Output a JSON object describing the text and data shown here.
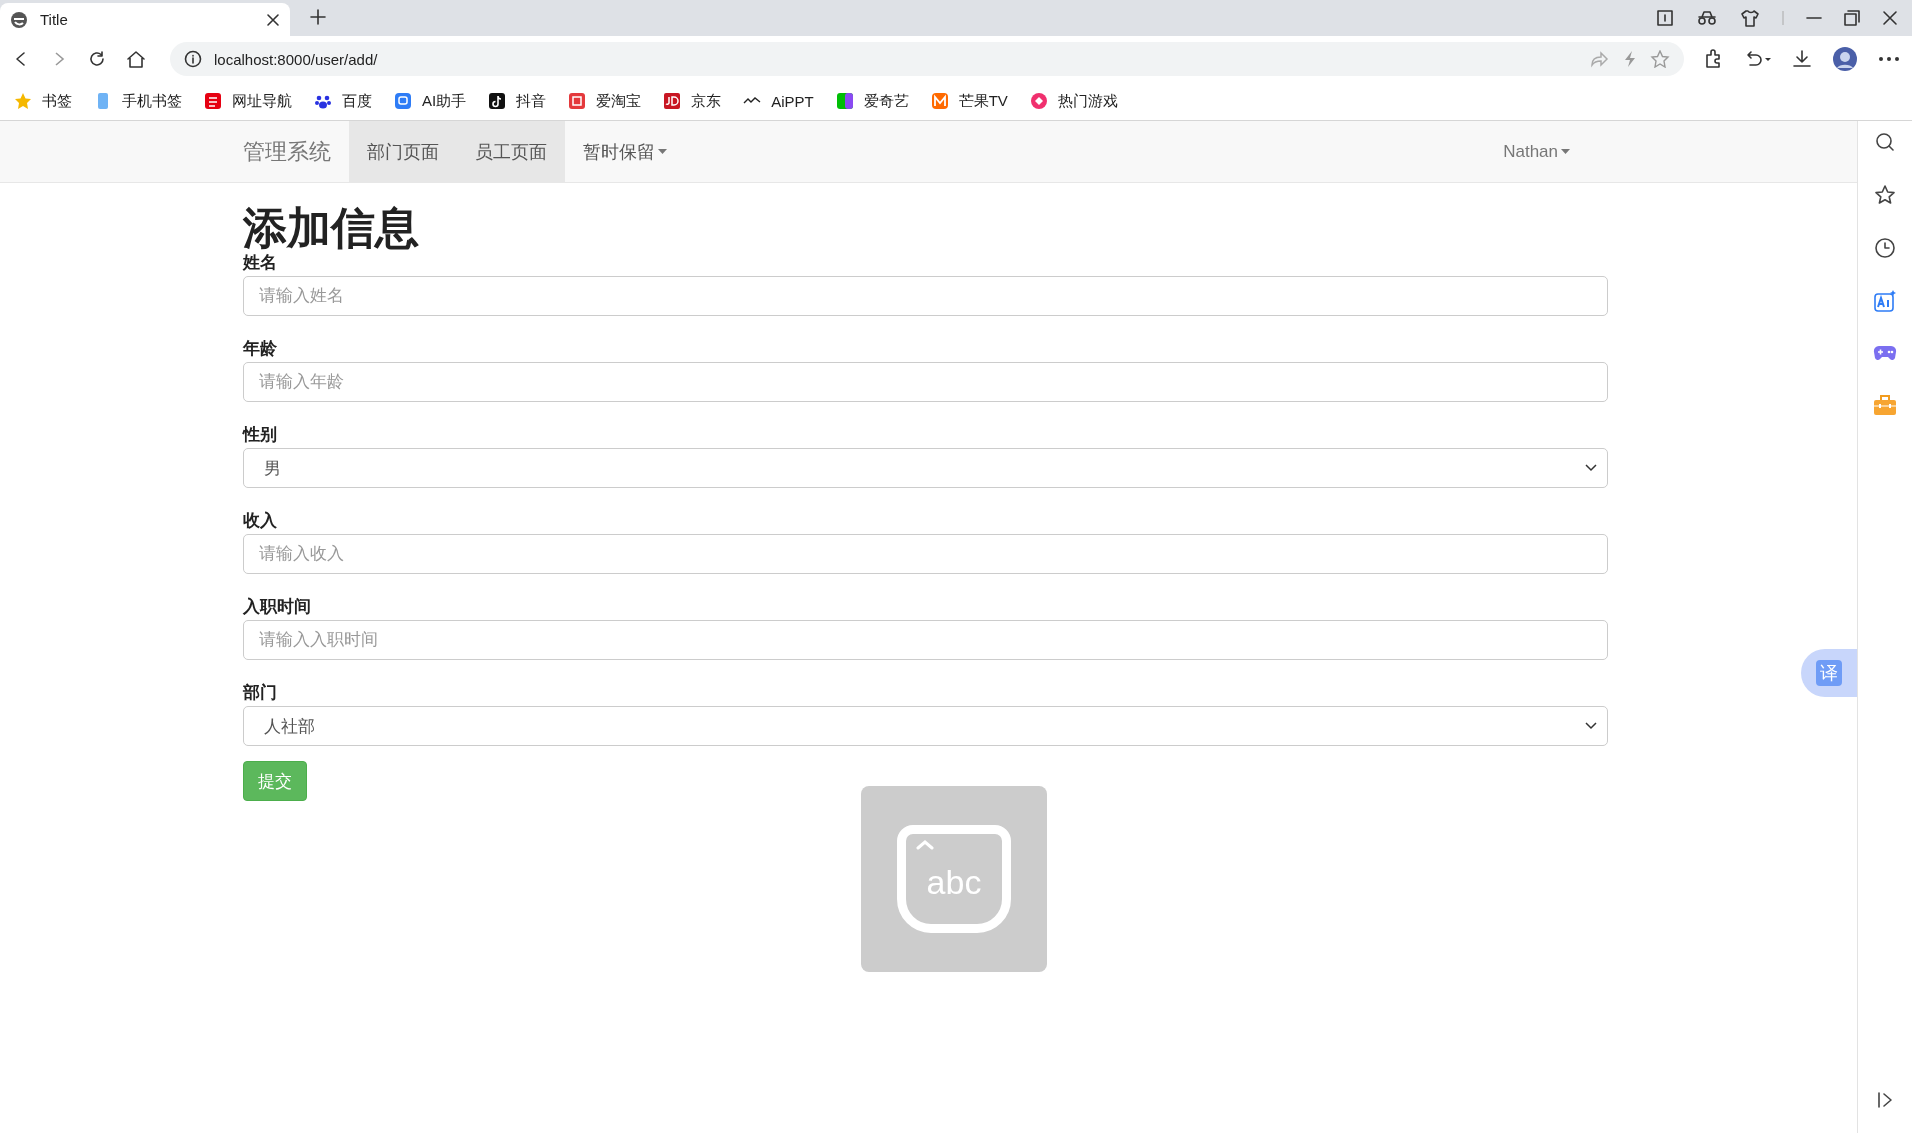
{
  "browser": {
    "tab_title": "Title",
    "url": "localhost:8000/user/add/"
  },
  "bookmarks": [
    {
      "label": "书签"
    },
    {
      "label": "手机书签"
    },
    {
      "label": "网址导航"
    },
    {
      "label": "百度"
    },
    {
      "label": "AI助手"
    },
    {
      "label": "抖音"
    },
    {
      "label": "爱淘宝"
    },
    {
      "label": "京东"
    },
    {
      "label": "AiPPT"
    },
    {
      "label": "爱奇艺"
    },
    {
      "label": "芒果TV"
    },
    {
      "label": "热门游戏"
    }
  ],
  "navbar": {
    "brand": "管理系统",
    "items": [
      {
        "label": "部门页面",
        "kind": "link",
        "selected": true
      },
      {
        "label": "员工页面",
        "kind": "link",
        "selected": true
      },
      {
        "label": "暂时保留",
        "kind": "dropdown",
        "selected": false
      }
    ],
    "user": "Nathan"
  },
  "form": {
    "title": "添加信息",
    "fields": [
      {
        "label": "姓名",
        "kind": "text",
        "placeholder": "请输入姓名"
      },
      {
        "label": "年龄",
        "kind": "text",
        "placeholder": "请输入年龄"
      },
      {
        "label": "性别",
        "kind": "select",
        "value": "男"
      },
      {
        "label": "收入",
        "kind": "text",
        "placeholder": "请输入收入"
      },
      {
        "label": "入职时间",
        "kind": "text",
        "placeholder": "请输入入职时间"
      },
      {
        "label": "部门",
        "kind": "select",
        "value": "人社部"
      }
    ],
    "submit": "提交"
  },
  "image_placeholder": {
    "text": "abc"
  },
  "translate_button": "译"
}
